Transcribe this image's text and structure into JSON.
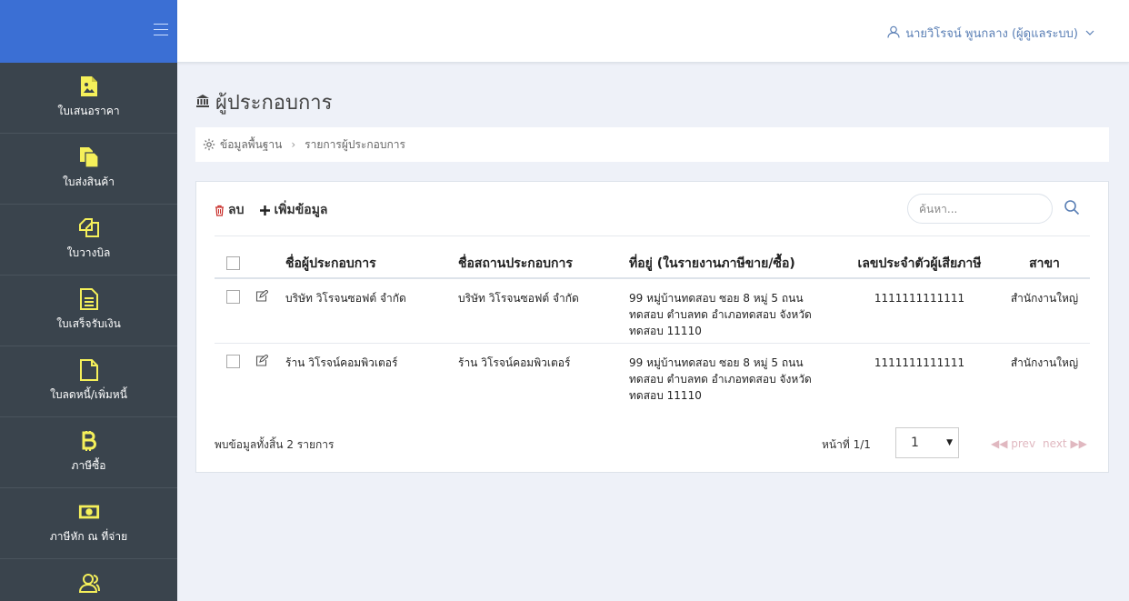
{
  "sidebar": {
    "items": [
      {
        "label": "ใบเสนอราคา",
        "icon": "image-file-icon"
      },
      {
        "label": "ใบส่งสินค้า",
        "icon": "copy-file-icon"
      },
      {
        "label": "ใบวางบิล",
        "icon": "clone-icon"
      },
      {
        "label": "ใบเสร็จรับเงิน",
        "icon": "document-text-icon"
      },
      {
        "label": "ใบลดหนี้/เพิ่มหนี้",
        "icon": "file-icon"
      },
      {
        "label": "ภาษีซื้อ",
        "icon": "bitcoin-icon"
      },
      {
        "label": "ภาษีหัก ณ ที่จ่าย",
        "icon": "money-bill-icon"
      },
      {
        "label": "",
        "icon": "users-icon"
      }
    ]
  },
  "header": {
    "user_name": "นายวิโรจน์ พูนกลาง (ผู้ดูแลระบบ)"
  },
  "page": {
    "title": "ผู้ประกอบการ"
  },
  "breadcrumb": {
    "root": "ข้อมูลพื้นฐาน",
    "current": "รายการผู้ประกอบการ"
  },
  "toolbar": {
    "delete_label": "ลบ",
    "add_label": "เพิ่มข้อมูล"
  },
  "search": {
    "placeholder": "ค้นหา..."
  },
  "table": {
    "headers": {
      "name": "ชื่อผู้ประกอบการ",
      "place": "ชื่อสถานประกอบการ",
      "address": "ที่อยู่ (ในรายงานภาษีขาย/ซื้อ)",
      "tax_id": "เลขประจำตัวผู้เสียภาษี",
      "branch": "สาขา"
    },
    "rows": [
      {
        "name": "บริษัท วิโรจนซอฟต์ จำกัด",
        "place": "บริษัท วิโรจนซอฟต์ จำกัด",
        "address_lines": [
          "99 หมู่บ้านทดสอบ ซอย 8 หมู่ 5 ถนน",
          "ทดสอบ ตำบลทด อำเภอทดสอบ จังหวัด",
          "ทดสอบ 11110"
        ],
        "tax_id": "1111111111111",
        "branch": "สำนักงานใหญ่"
      },
      {
        "name": "ร้าน วิโรจน์คอมพิวเตอร์",
        "place": "ร้าน วิโรจน์คอมพิวเตอร์",
        "address_lines": [
          "99 หมู่บ้านทดสอบ ซอย 8 หมู่ 5 ถนน",
          "ทดสอบ ตำบลทด อำเภอทดสอบ จังหวัด",
          "ทดสอบ 11110"
        ],
        "tax_id": "1111111111111",
        "branch": "สำนักงานใหญ่"
      }
    ]
  },
  "footer": {
    "total_text": "พบข้อมูลทั้งสิ้น 2 รายการ",
    "page_label": "หน้าที่ 1/1",
    "page_selected": "1",
    "prev_label": "◀◀ prev",
    "next_label": "next ▶▶"
  },
  "colors": {
    "sidebar_bg": "#3a444d",
    "sidebar_accent": "#3b6fd4",
    "sidebar_icon": "#f5f05a",
    "link_blue": "#5a7fb5"
  }
}
